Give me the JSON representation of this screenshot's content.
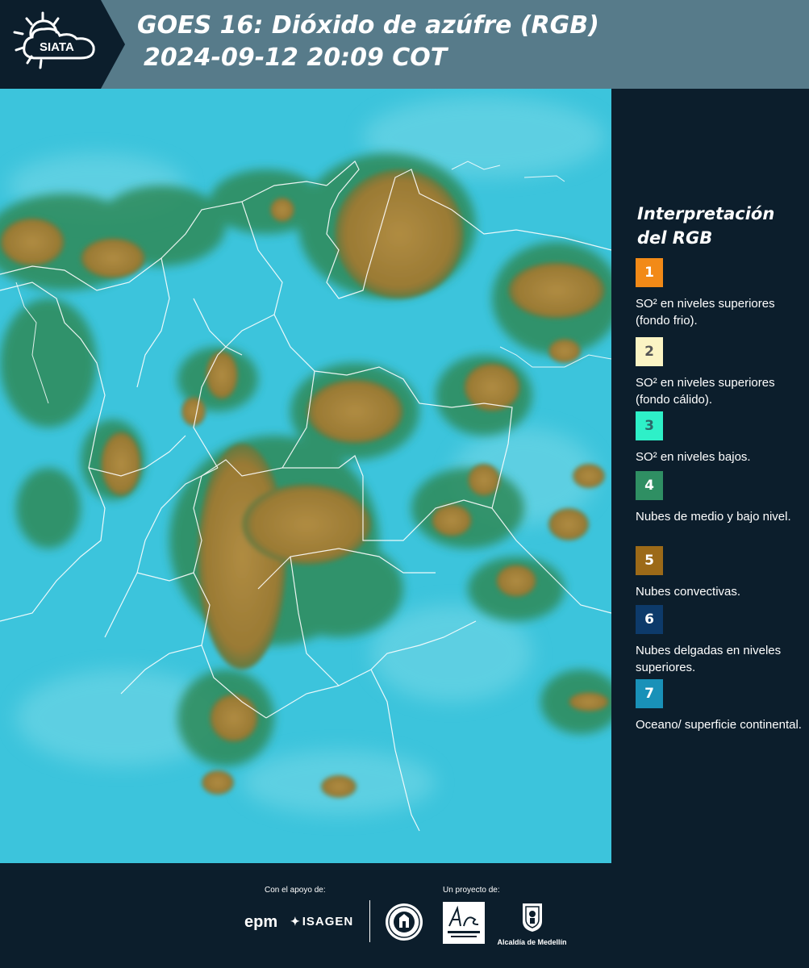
{
  "header": {
    "logo_text": "SIATA",
    "title_line1": "GOES 16: Dióxido de azúfre (RGB)",
    "title_line2": "2024-09-12 20:09 COT"
  },
  "map": {
    "description_icon": "satellite-map",
    "colors": {
      "ocean": "#3cc4dc",
      "convective": "#a8843c",
      "mid_low_cloud": "#2f8a5a",
      "boundary": "#ffffff"
    }
  },
  "legend": {
    "title": "Interpretación del RGB",
    "items": [
      {
        "number": "1",
        "label": "SO² en niveles superiores (fondo frio).",
        "color": "#f28a17",
        "text_color": "#ffffff"
      },
      {
        "number": "2",
        "label": "SO² en niveles superiores (fondo cálido).",
        "color": "#fbf4c4",
        "text_color": "#555555"
      },
      {
        "number": "3",
        "label": "SO² en niveles bajos.",
        "color": "#2ef0c8",
        "text_color": "#2a6a6a"
      },
      {
        "number": "4",
        "label": "Nubes de medio y bajo nivel.",
        "color": "#2f8f63",
        "text_color": "#ffffff"
      },
      {
        "number": "5",
        "label": "Nubes convectivas.",
        "color": "#9c6a18",
        "text_color": "#ffffff"
      },
      {
        "number": "6",
        "label": "Nubes delgadas en niveles superiores.",
        "color": "#0d3a6a",
        "text_color": "#ffffff"
      },
      {
        "number": "7",
        "label": "Oceano/ superficie continental.",
        "color": "#1991b8",
        "text_color": "#ffffff"
      }
    ]
  },
  "footer": {
    "support_caption": "Con el apoyo de:",
    "project_caption": "Un proyecto de:",
    "sponsors": [
      "epm",
      "ISAGEN"
    ],
    "partners": [
      "Medellín",
      "Área Metropolitana Valle de Aburrá",
      "Alcaldía de Medellín"
    ],
    "epm_label": "epm",
    "isagen_label": "ISAGEN",
    "alcaldia_label": "Alcaldía de Medellín"
  }
}
